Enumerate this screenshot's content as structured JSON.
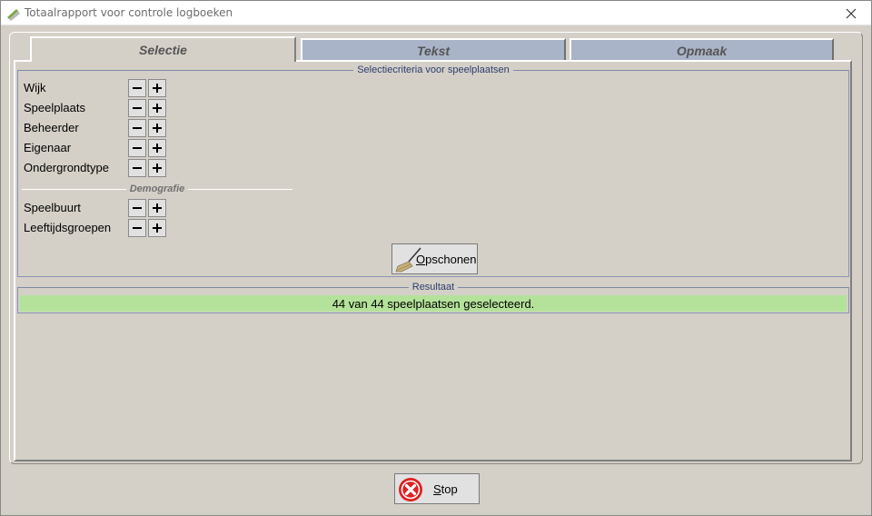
{
  "window": {
    "title": "Totaalrapport voor controle logboeken",
    "icon": "app-logo-icon",
    "close_icon": "close-icon"
  },
  "tabs": [
    {
      "label": "Selectie",
      "active": true
    },
    {
      "label": "Tekst",
      "active": false
    },
    {
      "label": "Opmaak",
      "active": false
    }
  ],
  "criteria": {
    "legend": "Selectiecriteria voor speelplaatsen",
    "items": [
      {
        "label": "Wijk"
      },
      {
        "label": "Speelplaats"
      },
      {
        "label": "Beheerder"
      },
      {
        "label": "Eigenaar"
      },
      {
        "label": "Ondergrondtype"
      }
    ],
    "demografie_label": "Demografie",
    "demografie_items": [
      {
        "label": "Speelbuurt"
      },
      {
        "label": "Leeftijdsgroepen"
      }
    ],
    "clean_button": {
      "mnemonic": "O",
      "rest": "pschonen",
      "icon": "broom-icon"
    }
  },
  "result": {
    "legend": "Resultaat",
    "text": "44 van 44 speelplaatsen geselecteerd.",
    "bar_color": "#b4e29a"
  },
  "stop_button": {
    "mnemonic": "S",
    "rest": "top",
    "icon": "stop-icon",
    "icon_color": "#e02020"
  }
}
